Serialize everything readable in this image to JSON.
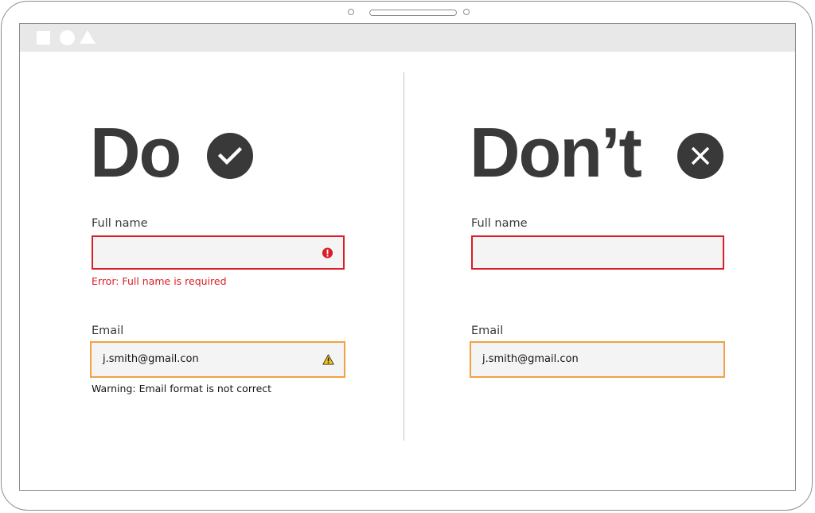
{
  "do_panel": {
    "heading": "Do",
    "badge_icon": "checkmark-icon",
    "name_field": {
      "label": "Full name",
      "value": "",
      "state_icon": "error-filled-icon",
      "helper_text": "Error: Full name is required"
    },
    "email_field": {
      "label": "Email",
      "value": "j.smith@gmail.con",
      "state_icon": "warning-icon",
      "helper_text": "Warning: Email format is not correct"
    }
  },
  "dont_panel": {
    "heading": "Don’t",
    "badge_icon": "close-icon",
    "name_field": {
      "label": "Full name",
      "value": ""
    },
    "email_field": {
      "label": "Email",
      "value": "j.smith@gmail.con"
    }
  },
  "colors": {
    "error": "#da1e28",
    "warning": "#f1a143",
    "heading": "#393939",
    "field_background": "#f4f4f4"
  }
}
